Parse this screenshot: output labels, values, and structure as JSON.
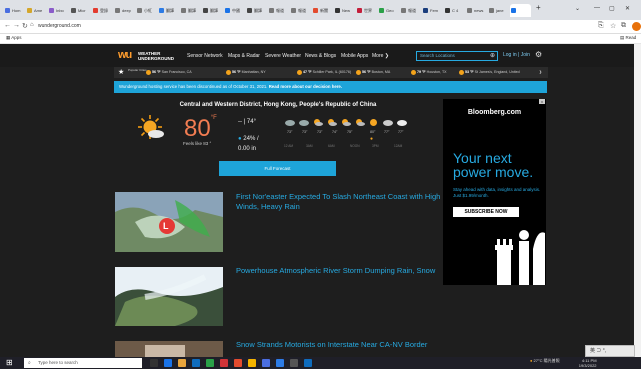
{
  "browser": {
    "tabs": [
      {
        "label": "Hom",
        "color": "#4a6ee0"
      },
      {
        "label": "Ame",
        "color": "#d4a62a"
      },
      {
        "label": "Inbo",
        "color": "#8a5cc9"
      },
      {
        "label": "Micr",
        "color": "#555555"
      },
      {
        "label": "登錄",
        "color": "#e33b2e"
      },
      {
        "label": "deep",
        "color": "#777777"
      },
      {
        "label": "小紅",
        "color": "#777777"
      },
      {
        "label": "翻譯",
        "color": "#2c7be5"
      },
      {
        "label": "翻譯",
        "color": "#777777"
      },
      {
        "label": "翻譯",
        "color": "#444444"
      },
      {
        "label": "中國",
        "color": "#1a73e8"
      },
      {
        "label": "翻譯",
        "color": "#444444"
      },
      {
        "label": "報道",
        "color": "#777777"
      },
      {
        "label": "報道",
        "color": "#777777"
      },
      {
        "label": "新聞",
        "color": "#e34b2e"
      },
      {
        "label": "New",
        "color": "#333333"
      },
      {
        "label": "世界",
        "color": "#c41e3a"
      },
      {
        "label": "Geo",
        "color": "#2aa148"
      },
      {
        "label": "報道",
        "color": "#777777"
      },
      {
        "label": "Fem",
        "color": "#1a3d7c"
      },
      {
        "label": "C 4",
        "color": "#333333"
      },
      {
        "label": "news",
        "color": "#777777"
      },
      {
        "label": "jane",
        "color": "#777777"
      },
      {
        "label": "",
        "color": "#1a73e8",
        "active": true
      }
    ],
    "new_tab": "+",
    "url": "wunderground.com",
    "bookmarks_apps": "Apps",
    "reading_list": "Read"
  },
  "site": {
    "logo_mark": "wu",
    "logo_line1": "WEATHER",
    "logo_line2": "UNDERGROUND",
    "menu": [
      "Sensor Network",
      "Maps & Radar",
      "Severe Weather",
      "News & Blogs",
      "Mobile Apps",
      "More ❯"
    ],
    "search_placeholder": "Search Locations",
    "login": "Log in | Join",
    "strip_label": "Popular Cities",
    "strip": [
      {
        "temp": "56 °F",
        "city": "San Francisco, CA"
      },
      {
        "temp": "56 °F",
        "city": "Manhattan, NY"
      },
      {
        "temp": "47 °F",
        "city": "Schiller Park, IL (60176)"
      },
      {
        "temp": "56 °F",
        "city": "Boston, MA"
      },
      {
        "temp": "79 °F",
        "city": "Houston, TX"
      },
      {
        "temp": "53 °F",
        "city": "St James's, England, United"
      }
    ],
    "banner_text": "Wunderground hosting service has been discontinued as of October 31, 2021.",
    "banner_link": "Read more about our decision here.",
    "location": "Central and Western District, Hong Kong, People's Republic of China",
    "current": {
      "temp": "80",
      "unit": "°F",
      "feels": "Feels like 83 °",
      "hilo": "-- | 74°",
      "precip_pct": "24% /",
      "precip_amt": "0.00 in"
    },
    "forecast_temps": [
      "73°",
      "73°",
      "73°",
      "74°",
      "75°",
      "80°",
      "77°",
      "77°"
    ],
    "forecast_labels": [
      "12 AM",
      "3AM",
      "6AM",
      "NOON",
      "3PM",
      "12AM"
    ],
    "full_forecast": "Full Forecast",
    "stories": [
      "First Nor'easter Expected To Slash Northeast Coast with High Winds, Heavy Rain",
      "Powerhouse Atmospheric River Storm Dumping Rain, Snow",
      "Snow Strands Motorists on Interstate Near CA-NV Border"
    ]
  },
  "ad": {
    "brand": "Bloomberg.com",
    "headline_1": "Your next",
    "headline_2": "power move.",
    "body": "Stay ahead with data, insights and analysis. Just $1.99/month.",
    "cta": "SUBSCRIBE NOW",
    "close": "x"
  },
  "taskbar": {
    "search": "Type here to search",
    "tray": "27°C 陽光普照",
    "time": "4:11 PM",
    "date": "19/3/2022",
    "ime": "英 ⊃ °,"
  }
}
